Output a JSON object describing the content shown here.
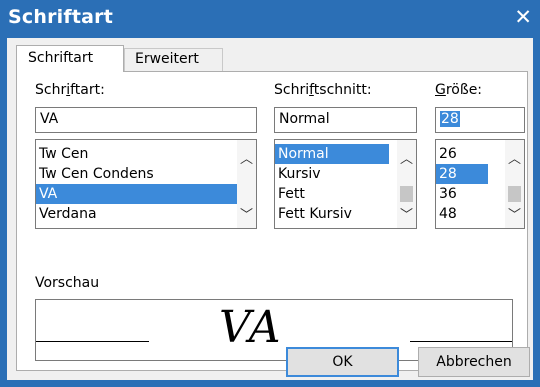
{
  "window": {
    "title": "Schriftart"
  },
  "tabs": [
    {
      "label": "Schriftart",
      "active": true
    },
    {
      "label": "Erweitert",
      "active": false
    }
  ],
  "font": {
    "label_pre": "Schr",
    "label_acc": "i",
    "label_post": "ftart:",
    "value": "VA",
    "items": [
      "Tw Cen",
      "Tw Cen Condens",
      "VA",
      "Verdana"
    ],
    "selected": "VA"
  },
  "style": {
    "label_pre": "Schri",
    "label_acc": "f",
    "label_post": "tschnitt:",
    "value": "Normal",
    "items": [
      "Normal",
      "Kursiv",
      "Fett",
      "Fett Kursiv"
    ],
    "selected": "Normal"
  },
  "size": {
    "label_acc": "G",
    "label_post": "röße:",
    "value": "28",
    "items": [
      "26",
      "28",
      "36",
      "48"
    ],
    "selected": "28"
  },
  "preview": {
    "label": "Vorschau",
    "sample": "VA"
  },
  "buttons": {
    "ok": "OK",
    "cancel": "Abbrechen"
  },
  "colors": {
    "titlebar": "#2b6fb6",
    "selection": "#3c8ada",
    "dialog_bg": "#f0f0f0"
  },
  "icons": {
    "close": "close-icon",
    "scroll_up": "chevron-up-icon",
    "scroll_down": "chevron-down-icon"
  }
}
